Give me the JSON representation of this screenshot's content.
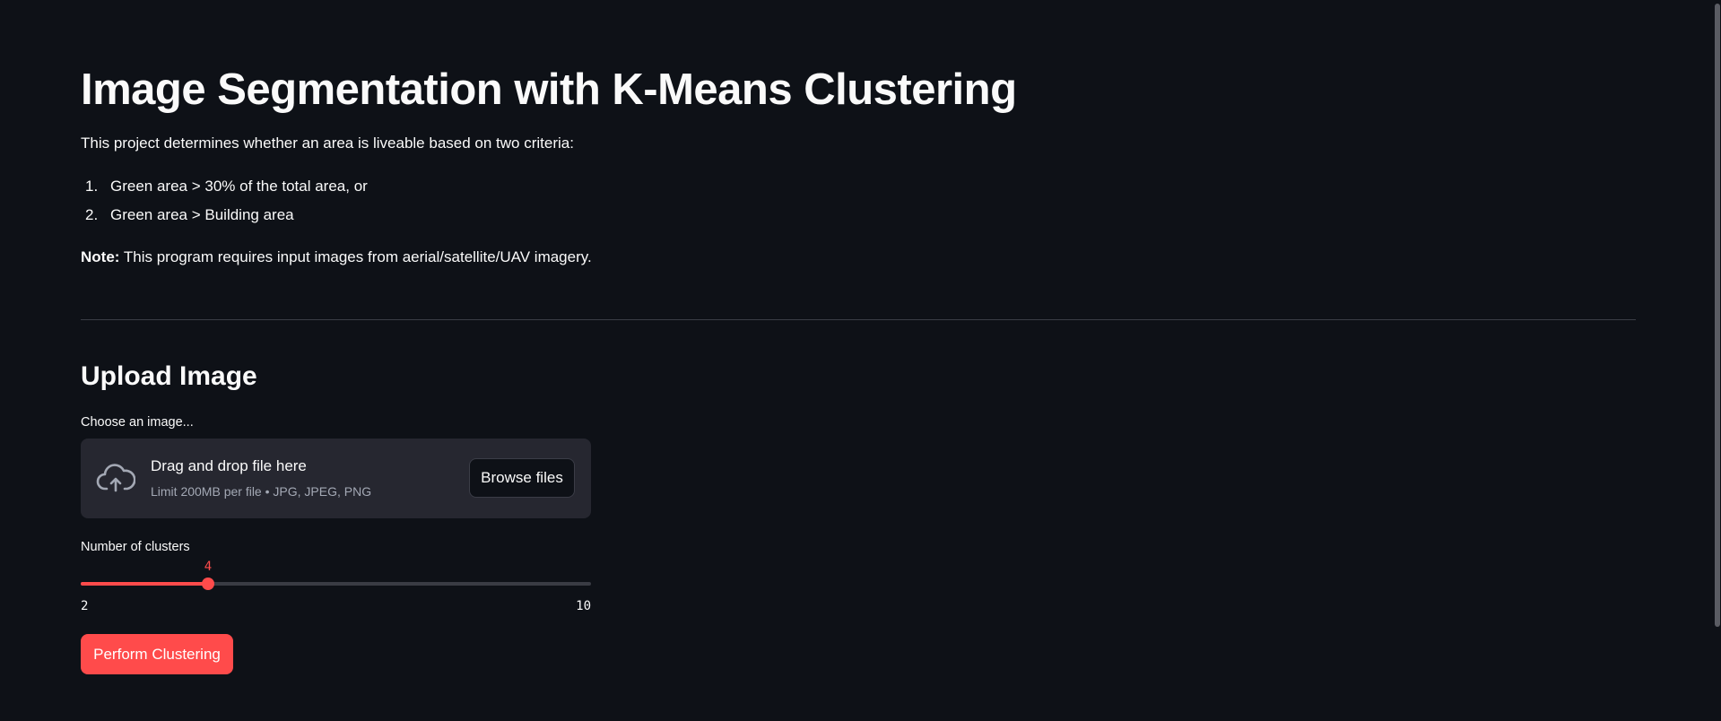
{
  "header": {
    "title": "Image Segmentation with K-Means Clustering"
  },
  "intro": {
    "text": "This project determines whether an area is liveable based on two criteria:",
    "criteria": [
      {
        "number": "1.",
        "text": "Green area > 30% of the total area, or"
      },
      {
        "number": "2.",
        "text": "Green area > Building area"
      }
    ],
    "note_label": "Note:",
    "note_text": " This program requires input images from aerial/satellite/UAV imagery."
  },
  "upload": {
    "subheader": "Upload Image",
    "label": "Choose an image...",
    "dropzone_title": "Drag and drop file here",
    "dropzone_limit": "Limit 200MB per file • JPG, JPEG, PNG",
    "browse_label": "Browse files",
    "icon": "cloud-upload-icon"
  },
  "slider": {
    "label": "Number of clusters",
    "min": 2,
    "max": 10,
    "value": 4,
    "min_label": "2",
    "max_label": "10",
    "value_label": "4"
  },
  "actions": {
    "perform_label": "Perform Clustering"
  },
  "colors": {
    "background": "#0e1117",
    "text": "#fafafa",
    "accent": "#ff4b4b",
    "panel": "#262730",
    "muted_text": "#a3a8b4"
  }
}
